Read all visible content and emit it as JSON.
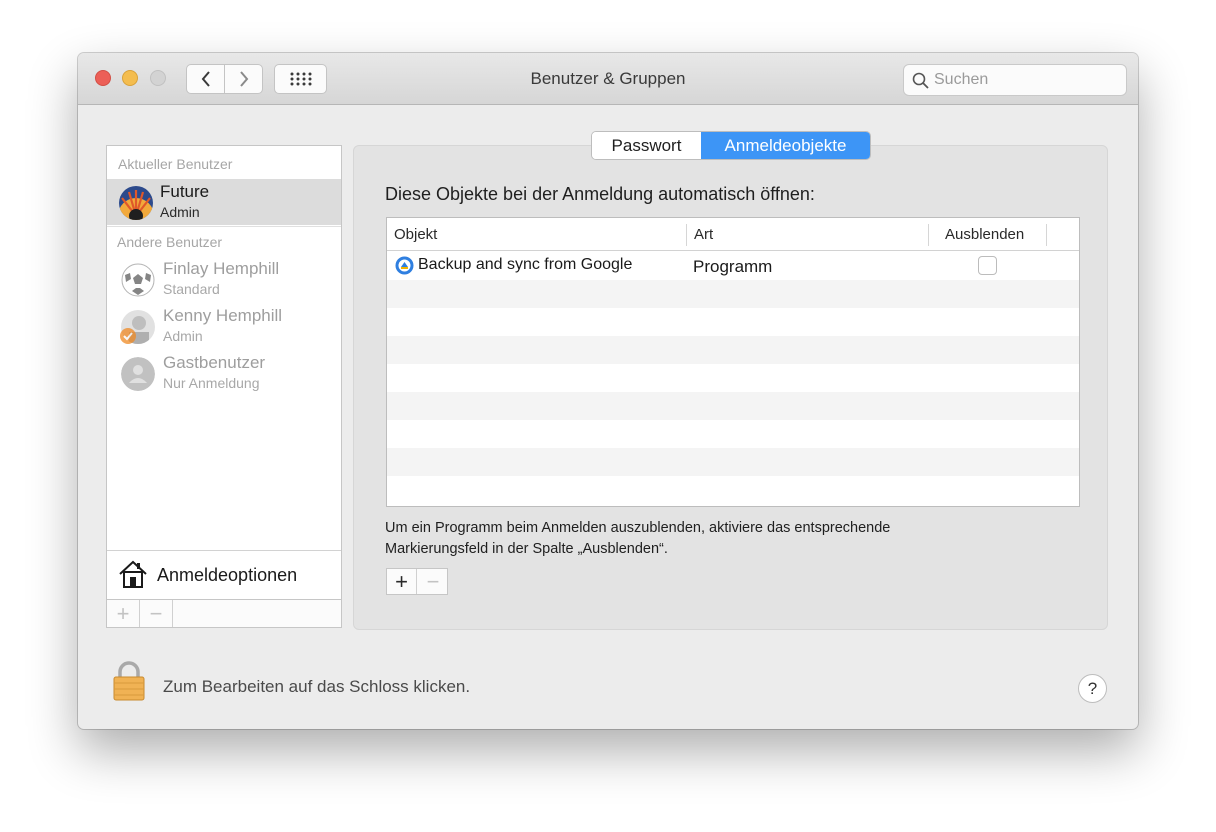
{
  "window": {
    "title": "Benutzer & Gruppen",
    "search_placeholder": "Suchen"
  },
  "sidebar": {
    "current_label": "Aktueller Benutzer",
    "other_label": "Andere Benutzer",
    "current_user": {
      "name": "Future",
      "role": "Admin"
    },
    "other_users": [
      {
        "name": "Finlay Hemphill",
        "role": "Standard"
      },
      {
        "name": "Kenny Hemphill",
        "role": "Admin"
      },
      {
        "name": "Gastbenutzer",
        "role": "Nur Anmeldung"
      }
    ],
    "login_options": "Anmeldeoptionen",
    "add_symbol": "+",
    "remove_symbol": "−"
  },
  "tabs": {
    "password": "Passwort",
    "login_items": "Anmeldeobjekte"
  },
  "content": {
    "heading": "Diese Objekte bei der Anmeldung automatisch öffnen:",
    "columns": [
      "Objekt",
      "Art",
      "Ausblenden"
    ],
    "items": [
      {
        "object": "Backup and sync from Google",
        "kind": "Programm",
        "hidden": false
      }
    ],
    "note_line1": "Um ein Programm beim Anmelden auszublenden, aktiviere das entsprechende",
    "note_line2": "Markierungsfeld in der Spalte „Ausblenden“.",
    "add_symbol": "+",
    "remove_symbol": "−"
  },
  "footer": {
    "lock_text": "Zum Bearbeiten auf das Schloss klicken.",
    "help_symbol": "?"
  },
  "colors": {
    "accent": "#3d95f6",
    "close": "#ec5f57",
    "minimize": "#f4bd4f",
    "lock": "#f0b254"
  },
  "icons": [
    "back-icon",
    "forward-icon",
    "grid-icon",
    "search-icon",
    "house-icon",
    "lock-icon",
    "sync-app-icon"
  ]
}
